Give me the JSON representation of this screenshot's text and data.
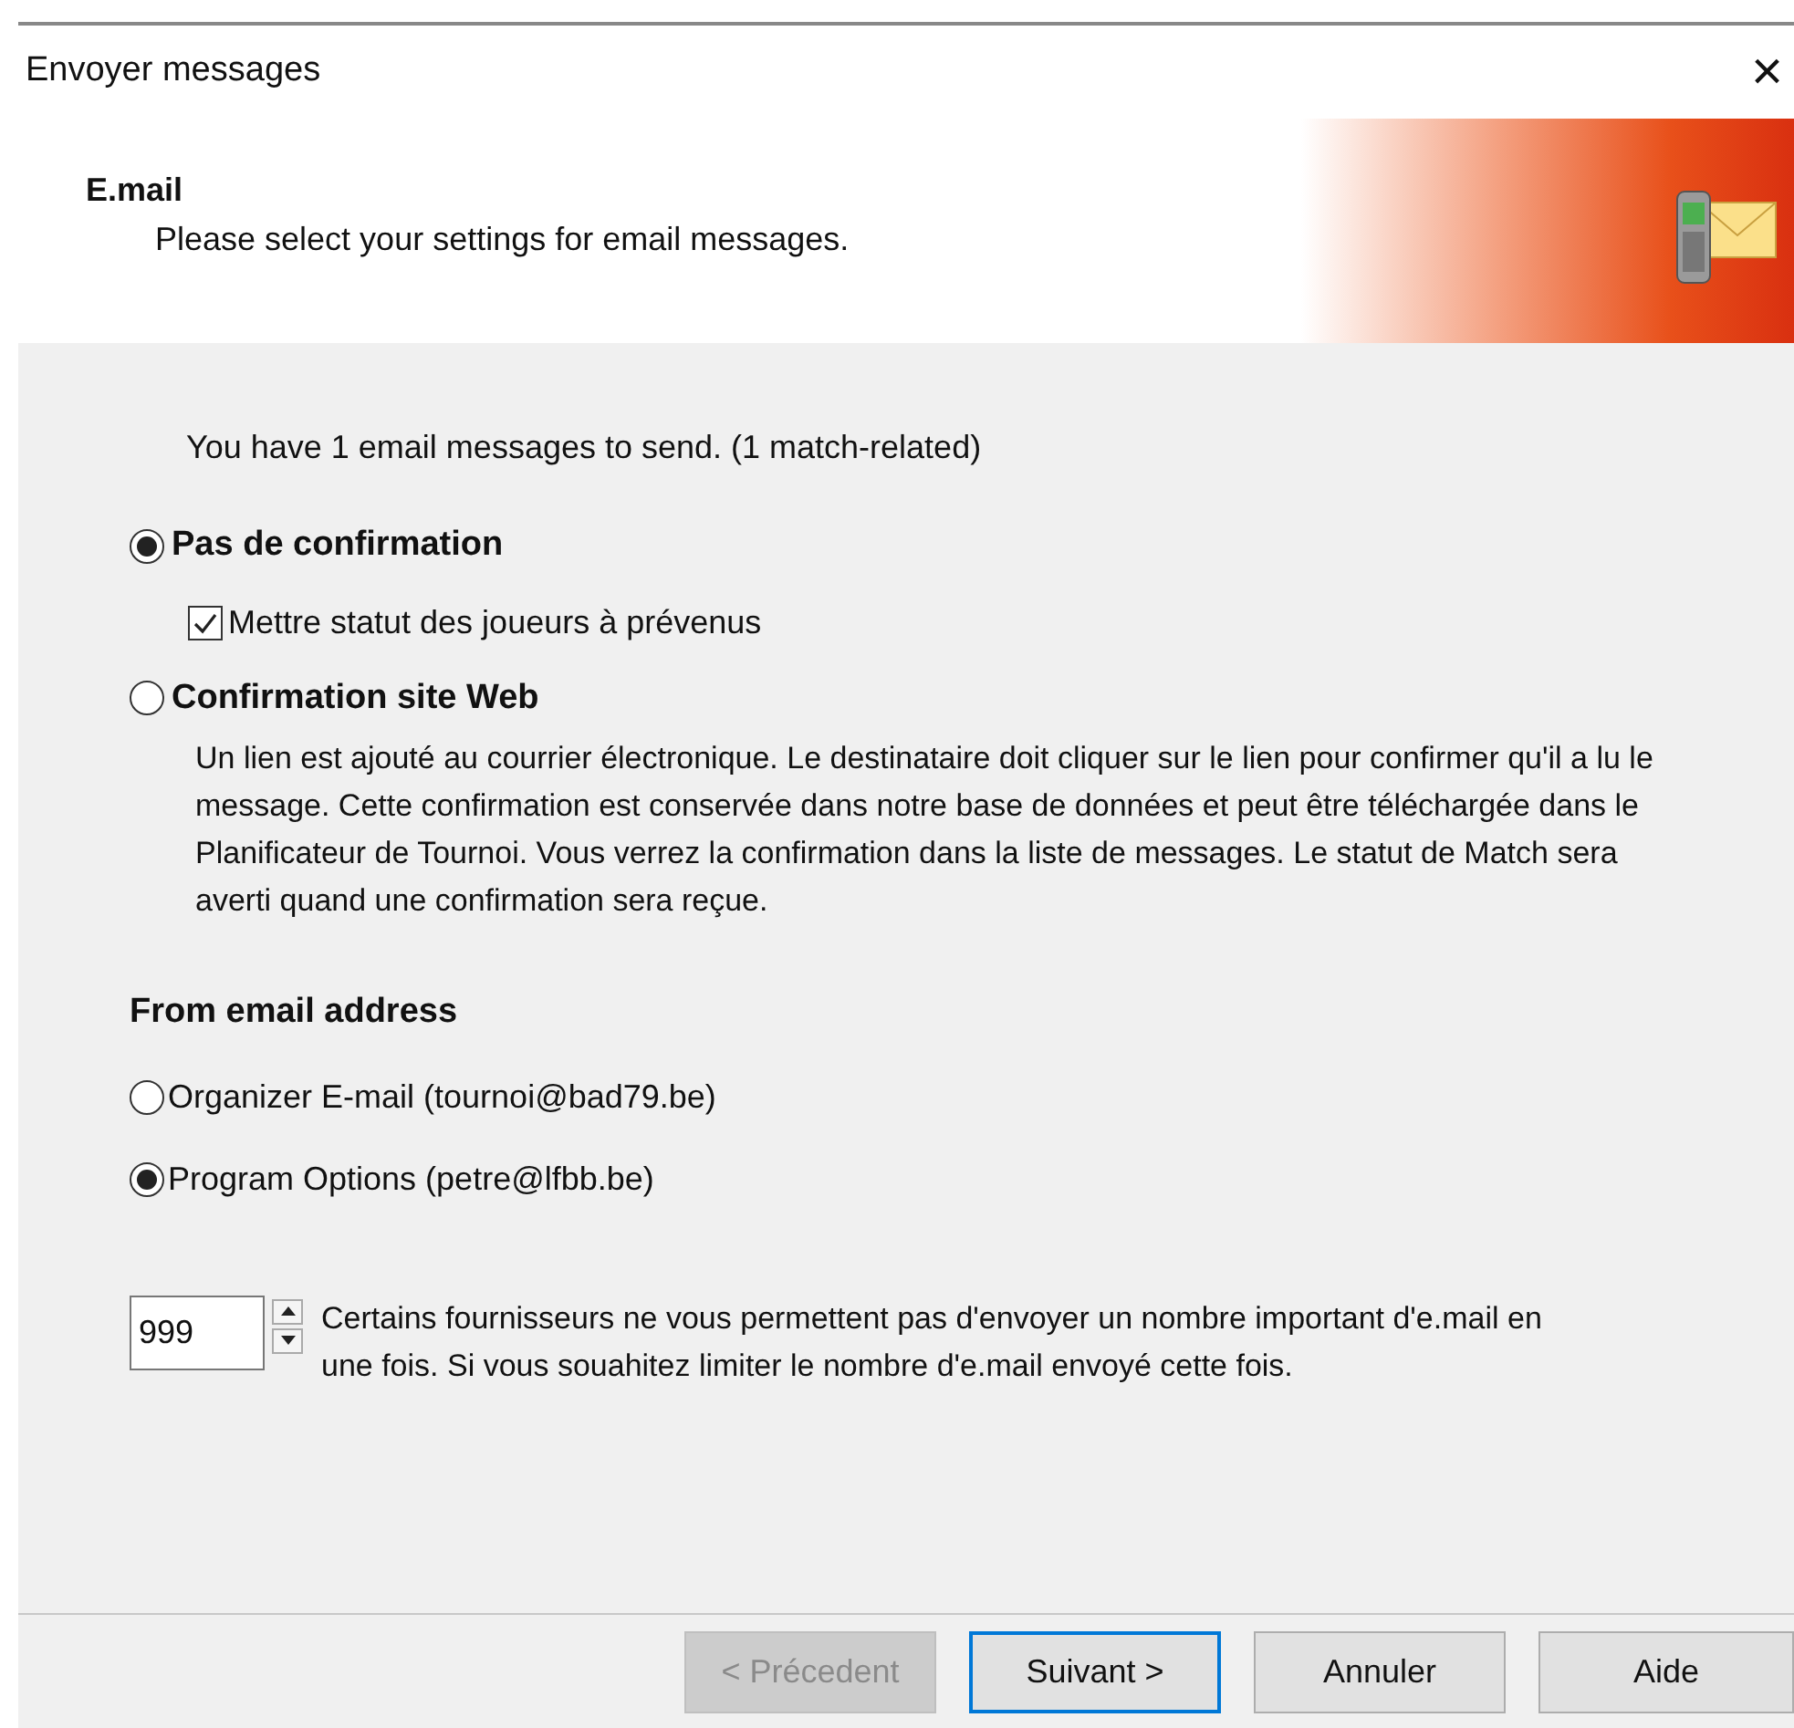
{
  "window": {
    "title": "Envoyer messages",
    "close": "×"
  },
  "header": {
    "title": "E.mail",
    "subtitle": "Please select your settings for email messages."
  },
  "summary": "You have 1 email messages to send.  (1 match-related)",
  "confirmation_options": [
    {
      "label": "Pas de confirmation",
      "selected": true,
      "checkbox": {
        "label": "Mettre statut des joueurs à prévenus",
        "checked": true
      }
    },
    {
      "label": "Confirmation site Web",
      "selected": false,
      "description": "Un lien est ajouté au courrier électronique. Le destinataire doit cliquer sur le lien pour confirmer qu'il a lu le message. Cette confirmation est conservée dans notre base de données et peut être téléchargée dans le Planificateur de Tournoi. Vous verrez la confirmation dans la liste de messages. Le statut de Match sera averti quand une confirmation sera reçue."
    }
  ],
  "from_address": {
    "heading": "From email address",
    "options": [
      {
        "label": "Organizer E-mail (tournoi@bad79.be)",
        "selected": false
      },
      {
        "label": "Program Options (petre@lfbb.be)",
        "selected": true
      }
    ]
  },
  "limit": {
    "value": "999",
    "description": "Certains fournisseurs ne vous  permettent pas d'envoyer un nombre important d'e.mail en une fois. Si vous souahitez limiter le nombre d'e.mail envoyé cette fois."
  },
  "buttons": [
    {
      "label": "< Précedent",
      "disabled": true,
      "default": false
    },
    {
      "label": "Suivant >",
      "disabled": false,
      "default": true
    },
    {
      "label": "Annuler",
      "disabled": false,
      "default": false
    },
    {
      "label": "Aide",
      "disabled": false,
      "default": false
    }
  ]
}
